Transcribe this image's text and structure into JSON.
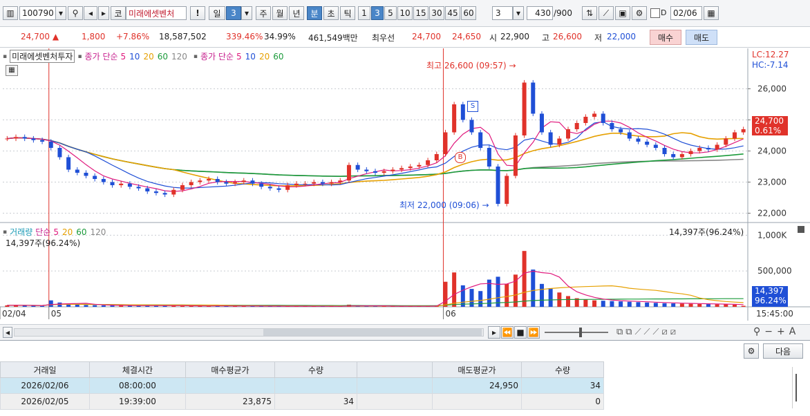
{
  "toolbar": {
    "code": "100790",
    "market_label": "코",
    "stock_name": "미래에셋벤처",
    "alert": "!",
    "period_day": "일",
    "period_day_n": "3",
    "period_week": "주",
    "period_month": "월",
    "period_year": "년",
    "period_min": "분",
    "period_sec": "초",
    "period_tick": "틱",
    "intervals": [
      "1",
      "3",
      "5",
      "10",
      "15",
      "30",
      "45",
      "60"
    ],
    "interval_selected": "3",
    "interval_input": "3",
    "count_value": "430",
    "count_total": "/900",
    "date_checkbox": "D",
    "date_value": "02/06"
  },
  "quote": {
    "price": "24,700",
    "change": "1,800",
    "change_pct": "+7.86%",
    "volume": "18,587,502",
    "vol_ratio": "339.46%",
    "turnover": "34.99%",
    "amount": "461,549백만",
    "best_ask_label": "최우선",
    "best_ask": "24,700",
    "best_bid": "24,650",
    "open_label": "시",
    "open": "22,900",
    "high_label": "고",
    "high": "26,600",
    "low_label": "저",
    "low": "22,000",
    "buy_btn": "매수",
    "sell_btn": "매도"
  },
  "price_legend": {
    "name": "미래에셋벤처투자",
    "ma1_title": "종가 단순",
    "ma1_periods": [
      "5",
      "10",
      "20",
      "60",
      "120"
    ],
    "ma2_title": "종가 단순",
    "ma2_periods": [
      "5",
      "10",
      "20",
      "60"
    ]
  },
  "price_axis": {
    "lc": "LC:12.27",
    "hc": "HC:-7.14",
    "ticks": [
      "26,000",
      "25,000",
      "24,000",
      "23,000",
      "22,000"
    ],
    "current": "24,700",
    "current_pct": "0.61%"
  },
  "annotations": {
    "high": "최고 26,600 (09:57)",
    "low": "최저 22,000 (09:06)",
    "s_marker": "S",
    "b_marker": "B"
  },
  "volume_legend": {
    "title": "거래량",
    "ma_title": "단순",
    "periods": [
      "5",
      "20",
      "60",
      "120"
    ],
    "left_readout": "14,397주(96.24%)",
    "right_readout": "14,397주(96.24%)"
  },
  "volume_axis": {
    "ticks": [
      "1,000K",
      "500,000"
    ],
    "current": "14,397",
    "current_pct": "96.24%"
  },
  "time_axis": {
    "labels": [
      "02/04",
      "05",
      "06"
    ],
    "clock": "15:45:00"
  },
  "panel": {
    "next_btn": "다음"
  },
  "trades": {
    "headers": [
      "거래일",
      "체결시간",
      "매수평균가",
      "수량",
      "",
      "매도평균가",
      "수량"
    ],
    "rows": [
      [
        "2026/02/06",
        "08:00:00",
        "",
        "",
        "",
        "24,950",
        "34"
      ],
      [
        "2026/02/05",
        "19:39:00",
        "23,875",
        "34",
        "",
        "",
        "0"
      ]
    ]
  },
  "colors": {
    "up": "#e0322a",
    "down": "#1f4fd6",
    "ma5": "#e0197d",
    "ma10": "#1f4fd6",
    "ma20": "#e6a000",
    "ma60": "#1a9a3a",
    "ma120": "#888888"
  },
  "chart_data": {
    "type": "line",
    "title": "",
    "price_range": [
      21700,
      27300
    ],
    "price_ticks": [
      22000,
      23000,
      24000,
      25000,
      26000
    ],
    "high": 26600,
    "low": 22000,
    "last": 24700,
    "volume_range": [
      0,
      1100000
    ],
    "volume_ticks": [
      500000,
      1000000
    ],
    "day_labels": [
      "02/04",
      "05",
      "06"
    ],
    "close_series": [
      24400,
      24450,
      24400,
      24350,
      24300,
      24100,
      23800,
      23400,
      23300,
      23200,
      23100,
      23000,
      22900,
      22950,
      22850,
      22800,
      22700,
      22650,
      22600,
      22750,
      22900,
      23000,
      23050,
      23100,
      23000,
      22950,
      23000,
      23050,
      22950,
      22850,
      22800,
      22750,
      22900,
      22950,
      22950,
      23000,
      22950,
      23000,
      23050,
      23550,
      23400,
      23350,
      23300,
      23350,
      23400,
      23450,
      23500,
      23550,
      23700,
      23900,
      24600,
      25500,
      25000,
      24600,
      24100,
      23500,
      22300,
      23200,
      24500,
      26200,
      25200,
      24600,
      24200,
      24400,
      24700,
      24900,
      25100,
      25200,
      24900,
      24700,
      24600,
      24400,
      24300,
      24200,
      24100,
      23900,
      23800,
      23900,
      24000,
      24100,
      24050,
      24200,
      24400,
      24600,
      24700
    ],
    "volume_series": [
      20000,
      25000,
      18000,
      15000,
      12000,
      90000,
      60000,
      40000,
      30000,
      25000,
      22000,
      20000,
      18000,
      16000,
      15000,
      14000,
      20000,
      18000,
      16000,
      14000,
      13000,
      12000,
      11000,
      10000,
      15000,
      12000,
      11000,
      10000,
      9000,
      9000,
      9000,
      9000,
      8000,
      8000,
      8000,
      7000,
      7000,
      7000,
      7000,
      30000,
      12000,
      10000,
      9000,
      8000,
      8000,
      8000,
      7000,
      7000,
      9000,
      20000,
      350000,
      480000,
      300000,
      250000,
      220000,
      380000,
      420000,
      320000,
      450000,
      780000,
      520000,
      320000,
      260000,
      200000,
      150000,
      120000,
      100000,
      90000,
      85000,
      80000,
      75000,
      70000,
      65000,
      60000,
      55000,
      50000,
      48000,
      45000,
      42000,
      40000,
      38000,
      36000,
      34000,
      30000,
      14397
    ]
  }
}
